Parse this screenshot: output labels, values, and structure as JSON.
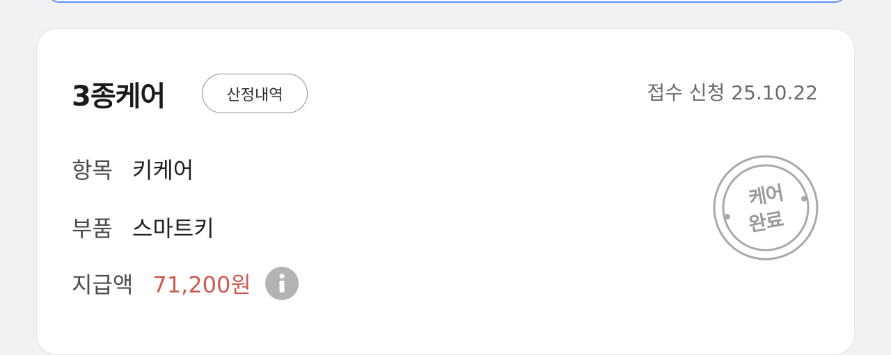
{
  "card": {
    "title": "3종케어",
    "badge_label": "산정내역",
    "date_text": "접수 신청 25.10.22",
    "rows": [
      {
        "label": "항목",
        "value": "키케어"
      },
      {
        "label": "부품",
        "value": "스마트키"
      },
      {
        "label": "지급액",
        "value": "71,200원"
      }
    ],
    "info_icon": "info-icon",
    "stamp": {
      "line1": "케어",
      "line2": "완료"
    }
  },
  "colors": {
    "amount": "#cf5a50",
    "stamp": "#9a9a9a",
    "top_bar_border": "#5b8def"
  }
}
